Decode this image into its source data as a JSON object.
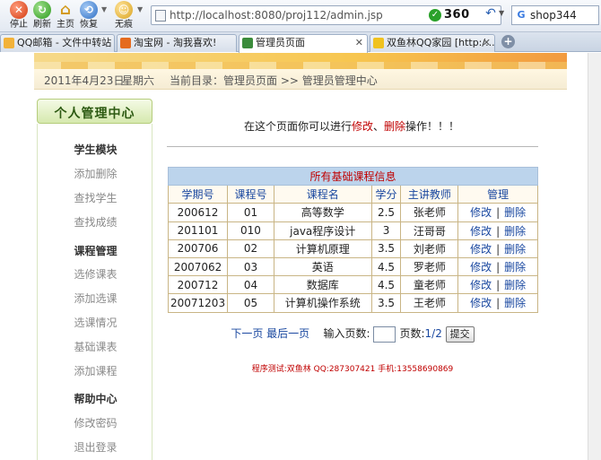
{
  "browser": {
    "buttons": {
      "stop": "停止",
      "refresh": "刷新",
      "home": "主页",
      "restore": "恢复",
      "noimg": "无痕"
    },
    "address": "http://localhost:8080/proj112/admin.jsp",
    "brand": "360",
    "search_text": "shop344",
    "tabs": [
      {
        "label": "QQ邮箱 - 文件中转站",
        "color": "#f2b23a"
      },
      {
        "label": "淘宝网 - 淘我喜欢!",
        "color": "#e56b1f"
      },
      {
        "label": "管理员页面",
        "color": "#3c8c3c"
      },
      {
        "label": "双鱼林QQ家园 [http:/...",
        "color": "#f0c21f"
      }
    ]
  },
  "infobar": {
    "date": "2011年4月23日",
    "weekday": "星期六",
    "breadcrumb": "当前目录：管理员页面 >> 管理员管理中心"
  },
  "sidebar": {
    "title": "个人管理中心",
    "items": [
      {
        "label": "学生模块",
        "type": "head"
      },
      {
        "label": "添加删除",
        "type": "link"
      },
      {
        "label": "查找学生",
        "type": "link"
      },
      {
        "label": "查找成绩",
        "type": "link"
      },
      {
        "label": "课程管理",
        "type": "head"
      },
      {
        "label": "选修课表",
        "type": "link"
      },
      {
        "label": "添加选课",
        "type": "link"
      },
      {
        "label": "选课情况",
        "type": "link"
      },
      {
        "label": "基础课表",
        "type": "link"
      },
      {
        "label": "添加课程",
        "type": "link"
      },
      {
        "label": "帮助中心",
        "type": "head"
      },
      {
        "label": "修改密码",
        "type": "link"
      },
      {
        "label": "退出登录",
        "type": "link"
      }
    ]
  },
  "intro": {
    "prefix": "在这个页面你可以进行",
    "modify": "修改",
    "sep": "、",
    "delete": "删除",
    "suffix": "操作！！！"
  },
  "table": {
    "caption": "所有基础课程信息",
    "headers": [
      "学期号",
      "课程号",
      "课程名",
      "学分",
      "主讲教师",
      "管理"
    ],
    "edit_label": "修改",
    "delete_label": "删除",
    "rows": [
      [
        "200612",
        "01",
        "高等数学",
        "2.5",
        "张老师"
      ],
      [
        "201101",
        "010",
        "java程序设计",
        "3",
        "汪哥哥"
      ],
      [
        "200706",
        "02",
        "计算机原理",
        "3.5",
        "刘老师"
      ],
      [
        "2007062",
        "03",
        "英语",
        "4.5",
        "罗老师"
      ],
      [
        "200712",
        "04",
        "数据库",
        "4.5",
        "童老师"
      ],
      [
        "20071203",
        "05",
        "计算机操作系统",
        "3.5",
        "王老师"
      ]
    ]
  },
  "pager": {
    "next": "下一页",
    "last": "最后一页",
    "input_label": "输入页数:",
    "pages_label": "页数:",
    "pages_value": "1/2",
    "submit": "提交"
  },
  "footer": "程序测试:双鱼林 QQ:287307421 手机:13558690869"
}
